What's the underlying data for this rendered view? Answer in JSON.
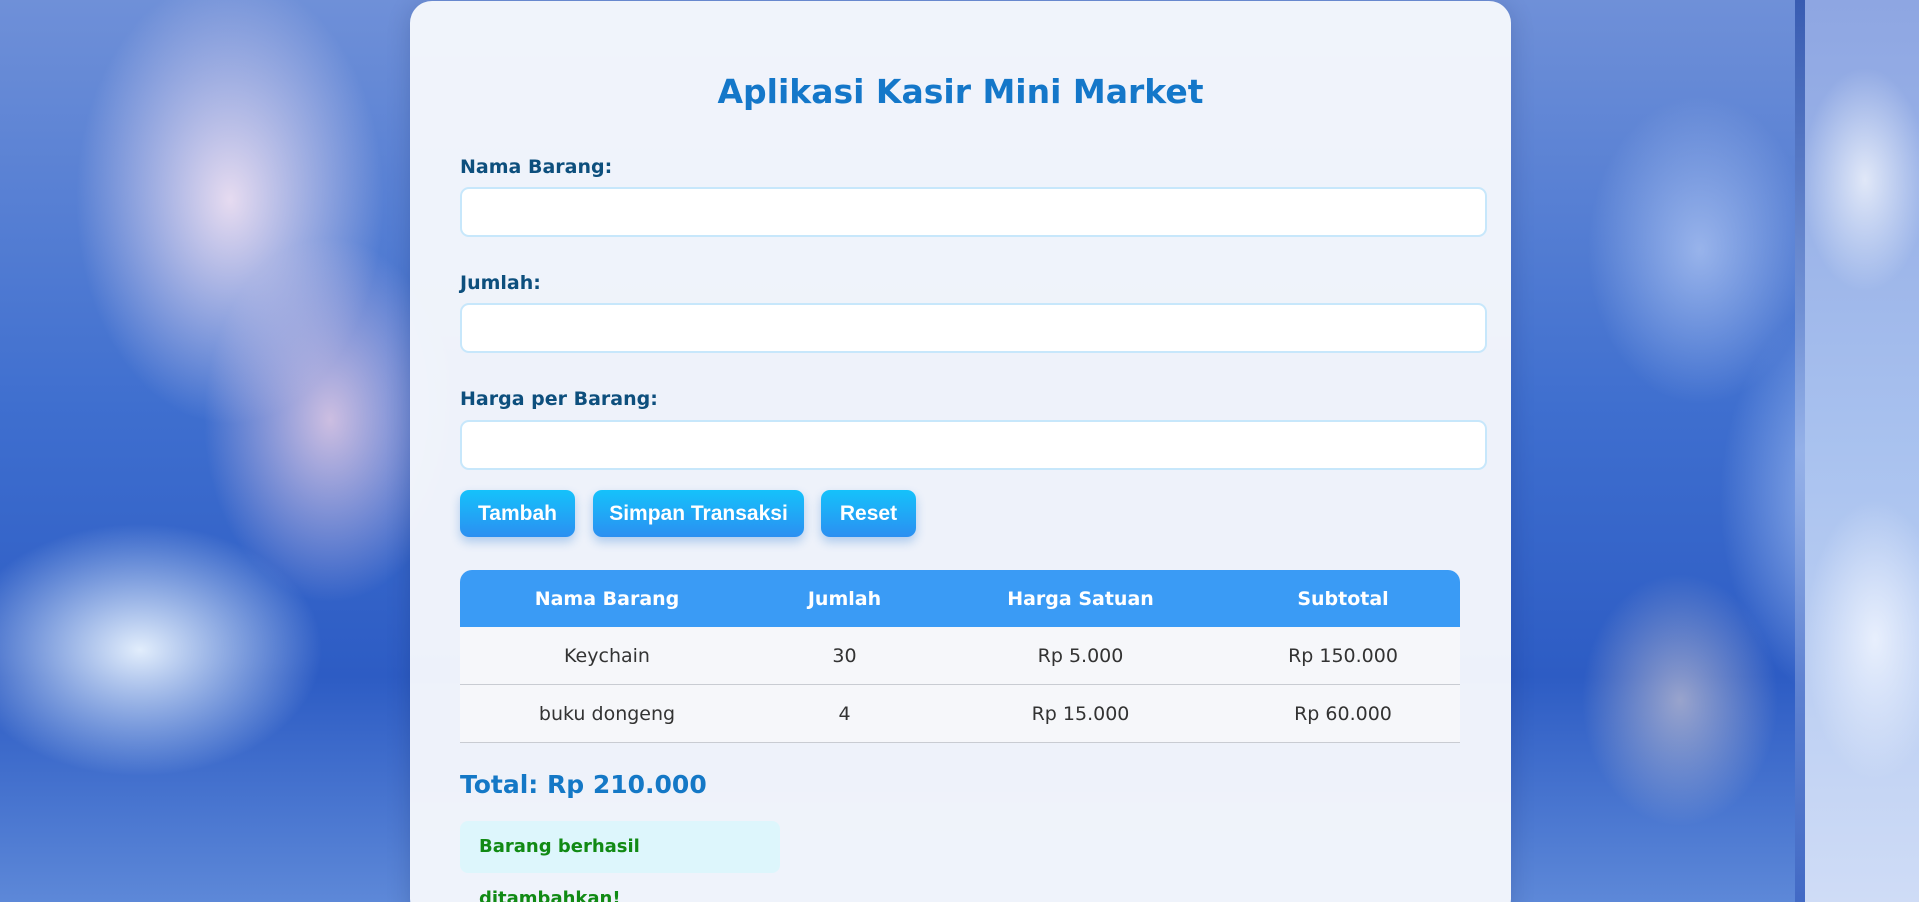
{
  "app": {
    "title": "Aplikasi Kasir Mini Market"
  },
  "form": {
    "nama_label": "Nama Barang:",
    "nama_value": "",
    "jumlah_label": "Jumlah:",
    "jumlah_value": "",
    "harga_label": "Harga per Barang:",
    "harga_value": ""
  },
  "buttons": {
    "tambah": "Tambah",
    "simpan": "Simpan Transaksi",
    "reset": "Reset"
  },
  "table": {
    "headers": [
      "Nama Barang",
      "Jumlah",
      "Harga Satuan",
      "Subtotal"
    ],
    "rows": [
      [
        "Keychain",
        "30",
        "Rp 5.000",
        "Rp 150.000"
      ],
      [
        "buku dongeng",
        "4",
        "Rp 15.000",
        "Rp 60.000"
      ]
    ]
  },
  "summary": {
    "total": "Total: Rp 210.000",
    "message": "Barang berhasil ditambahkan!"
  },
  "colors": {
    "title": "#1477c9",
    "label": "#0d4f7d",
    "table_header": "#3a9bf5",
    "button_top": "#15c2fb",
    "button_bottom": "#2b8ff1",
    "total": "#1478c6",
    "success_text": "#118a14",
    "success_bg": "#ddf6fc"
  }
}
